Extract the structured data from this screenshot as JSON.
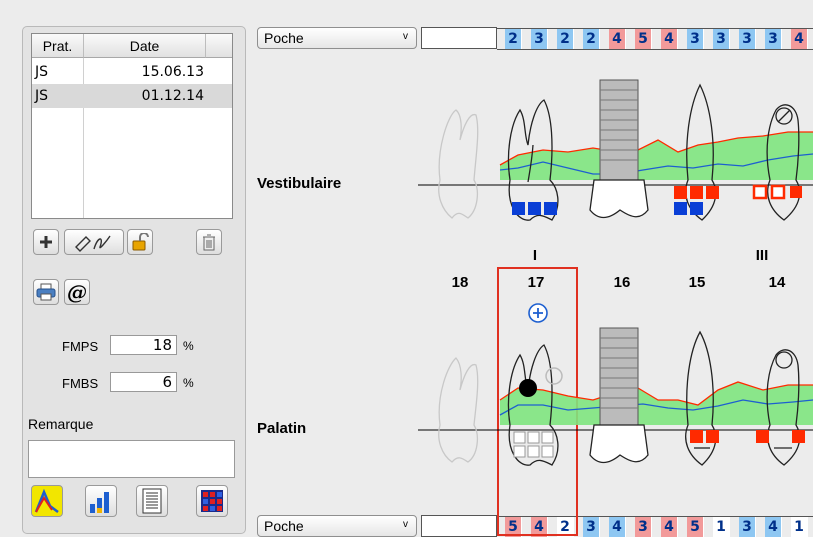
{
  "session_table": {
    "headers": {
      "prat": "Prat.",
      "date": "Date"
    },
    "rows": [
      {
        "prat": "JS",
        "date": "15.06.13",
        "selected": false
      },
      {
        "prat": "JS",
        "date": "01.12.14",
        "selected": true
      }
    ]
  },
  "toolbar_icons": [
    "plus-icon",
    "edit-icon",
    "lock-icon",
    "trash-icon",
    "print-icon",
    "email-icon"
  ],
  "email_glyph": "@",
  "fmps": {
    "label": "FMPS",
    "value": "18",
    "unit": "%"
  },
  "fmbs": {
    "label": "FMBS",
    "value": "6",
    "unit": "%"
  },
  "remark": {
    "label": "Remarque",
    "value": ""
  },
  "chart_icons": [
    "line-chart-icon",
    "bar-chart-icon",
    "text-list-icon",
    "grid-chart-icon"
  ],
  "top_strip": {
    "select": "Poche",
    "cells": [
      {
        "v": "2",
        "c": "blue"
      },
      {
        "v": "3",
        "c": "blue"
      },
      {
        "v": "2",
        "c": "blue"
      },
      {
        "v": "2",
        "c": "blue"
      },
      {
        "v": "4",
        "c": "red"
      },
      {
        "v": "5",
        "c": "red"
      },
      {
        "v": "4",
        "c": "red"
      },
      {
        "v": "3",
        "c": "blue"
      },
      {
        "v": "3",
        "c": "blue"
      },
      {
        "v": "3",
        "c": "blue"
      },
      {
        "v": "3",
        "c": "blue"
      },
      {
        "v": "4",
        "c": "red"
      }
    ]
  },
  "bottom_strip": {
    "select": "Poche",
    "cells": [
      {
        "v": "5",
        "c": "red"
      },
      {
        "v": "4",
        "c": "red"
      },
      {
        "v": "2",
        "c": "white"
      },
      {
        "v": "3",
        "c": "blue"
      },
      {
        "v": "4",
        "c": "blue"
      },
      {
        "v": "3",
        "c": "red"
      },
      {
        "v": "4",
        "c": "red"
      },
      {
        "v": "5",
        "c": "red"
      },
      {
        "v": "1",
        "c": "white"
      },
      {
        "v": "3",
        "c": "blue"
      },
      {
        "v": "4",
        "c": "blue"
      },
      {
        "v": "1",
        "c": "white"
      }
    ]
  },
  "vestibulaire_label": "Vestibulaire",
  "palatin_label": "Palatin",
  "tooth_numbers": [
    "18",
    "17",
    "16",
    "15",
    "14"
  ],
  "mobility": [
    {
      "tooth": "17",
      "grade": "I"
    },
    {
      "tooth": "14",
      "grade": "III"
    }
  ],
  "selected_tooth": "17",
  "add_icon": "plus-circle-icon",
  "colors": {
    "pocket_blue": "#8ec7f2",
    "pocket_red": "#f29a9a",
    "gum_green": "#7fe57f",
    "marker_red": "#ff2a00",
    "marker_blue": "#0a3fd6",
    "selection": "#e03020"
  }
}
